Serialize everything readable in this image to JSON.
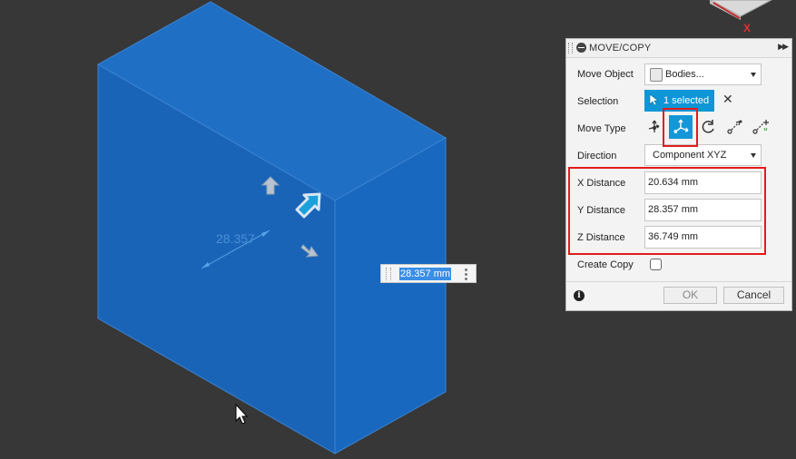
{
  "viewport": {
    "dimension_label": "28.357",
    "inline_input_value": "28.357 mm",
    "view_cube_axis": "X"
  },
  "panel": {
    "title": "MOVE/COPY",
    "rows": {
      "move_object": {
        "label": "Move Object",
        "value": "Bodies..."
      },
      "selection": {
        "label": "Selection",
        "value": "1 selected"
      },
      "move_type": {
        "label": "Move Type",
        "active": "translate",
        "options": [
          "free-move",
          "translate",
          "rotate",
          "point-to-point",
          "point-to-position"
        ]
      },
      "direction": {
        "label": "Direction",
        "value": "Component XYZ"
      },
      "x_distance": {
        "label": "X Distance",
        "value": "20.634 mm"
      },
      "y_distance": {
        "label": "Y Distance",
        "value": "28.357 mm"
      },
      "z_distance": {
        "label": "Z Distance",
        "value": "36.749 mm"
      },
      "create_copy": {
        "label": "Create Copy",
        "checked": false
      }
    },
    "buttons": {
      "ok": "OK",
      "cancel": "Cancel"
    }
  },
  "colors": {
    "background": "#373737",
    "body_front": "#1a64b8",
    "body_top": "#1f6fc5",
    "body_side": "#1868bf",
    "accent": "#0f96d6",
    "highlight": "#e31b1b"
  }
}
